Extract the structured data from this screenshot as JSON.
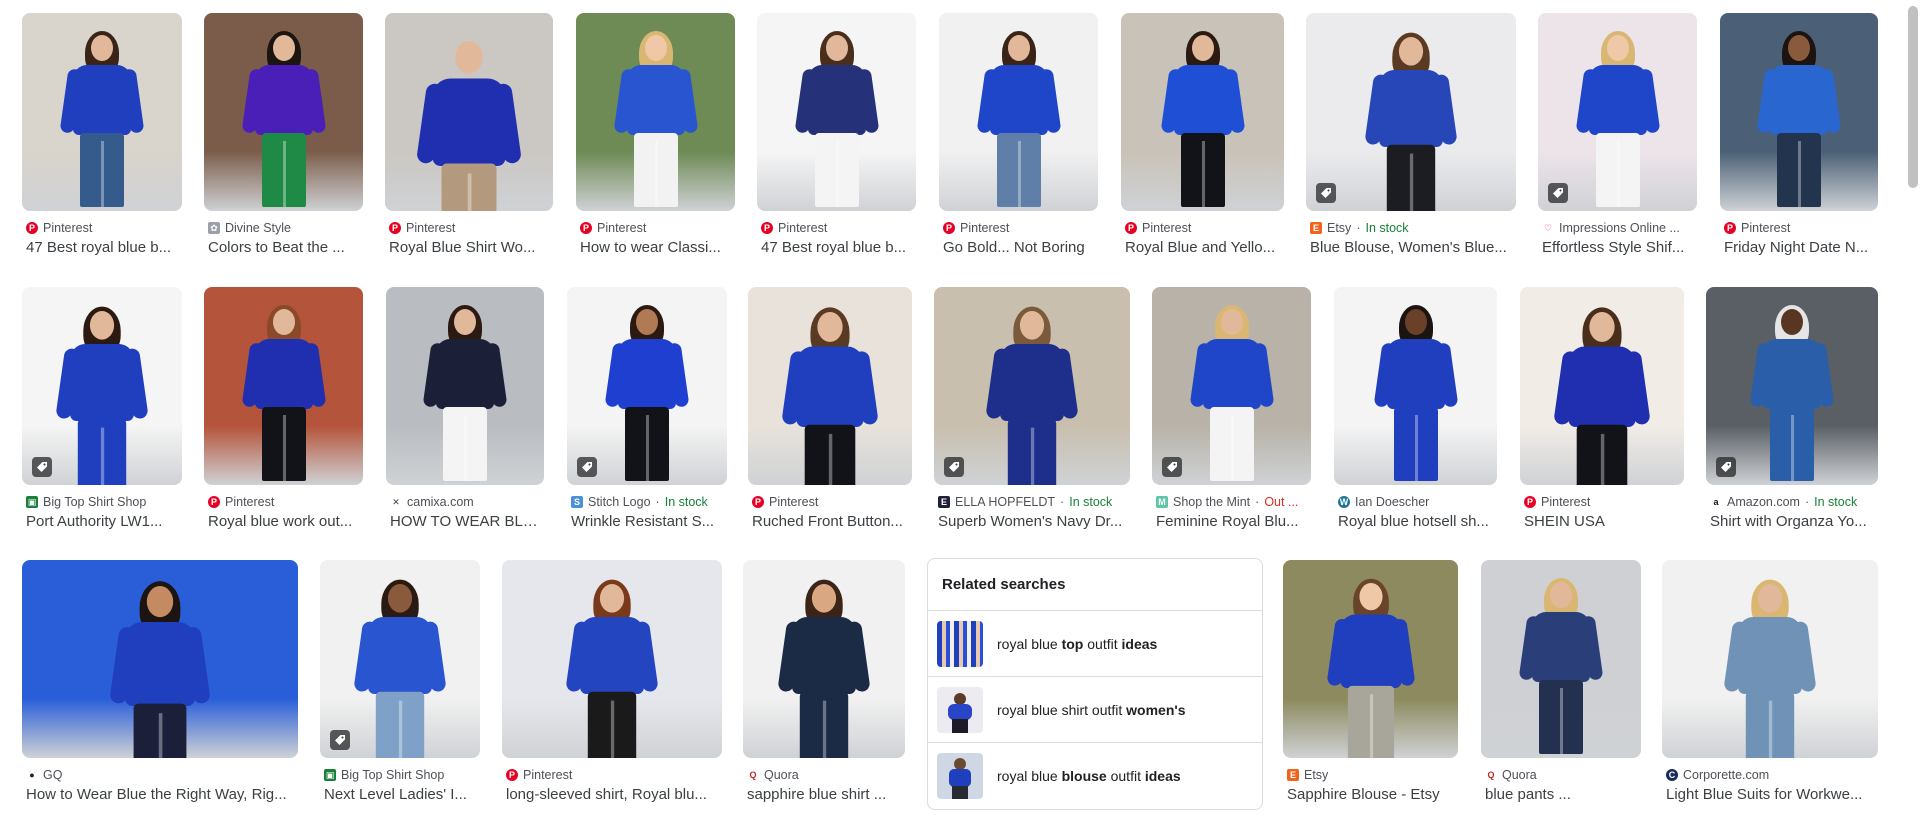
{
  "accent_blue": "#1f3fbf",
  "row1": [
    {
      "source": "Pinterest",
      "title": "47 Best royal blue b...",
      "fav": "pinterest",
      "shop": false
    },
    {
      "source": "Divine Style",
      "title": "Colors to Beat the ...",
      "fav": "divine",
      "shop": false
    },
    {
      "source": "Pinterest",
      "title": "Royal Blue Shirt Wo...",
      "fav": "pinterest",
      "shop": false
    },
    {
      "source": "Pinterest",
      "title": "How to wear Classi...",
      "fav": "pinterest",
      "shop": false
    },
    {
      "source": "Pinterest",
      "title": "47 Best royal blue b...",
      "fav": "pinterest",
      "shop": false
    },
    {
      "source": "Pinterest",
      "title": "Go Bold... Not Boring",
      "fav": "pinterest",
      "shop": false
    },
    {
      "source": "Pinterest",
      "title": "Royal Blue and Yello...",
      "fav": "pinterest",
      "shop": false
    },
    {
      "source": "Etsy",
      "stock": "In stock",
      "title": "Blue Blouse, Women's Blue...",
      "fav": "etsy",
      "shop": true
    },
    {
      "source": "Impressions Online ...",
      "title": "Effortless Style Shif...",
      "fav": "heart",
      "shop": true
    },
    {
      "source": "Pinterest",
      "title": "Friday Night Date N...",
      "fav": "pinterest",
      "shop": false
    }
  ],
  "row2": [
    {
      "source": "Big Top Shirt Shop",
      "title": "Port Authority LW1...",
      "fav": "bigtop",
      "shop": true
    },
    {
      "source": "Pinterest",
      "title": "Royal blue work out...",
      "fav": "pinterest",
      "shop": false
    },
    {
      "source": "camixa.com",
      "title": "HOW TO WEAR BLU...",
      "fav": "camixa",
      "shop": false
    },
    {
      "source": "Stitch Logo",
      "stock": "In stock",
      "title": "Wrinkle Resistant S...",
      "fav": "stitch",
      "shop": true
    },
    {
      "source": "Pinterest",
      "title": "Ruched Front Button...",
      "fav": "pinterest",
      "shop": false
    },
    {
      "source": "ELLA HOPFELDT",
      "stock": "In stock",
      "title": "Superb Women's Navy Dr...",
      "fav": "ella",
      "shop": true
    },
    {
      "source": "Shop the Mint",
      "stock": "Out ...",
      "title": "Feminine Royal Blu...",
      "fav": "mint",
      "shop": true
    },
    {
      "source": "Ian Doescher",
      "title": "Royal blue hotsell sh...",
      "fav": "wordpress",
      "shop": false
    },
    {
      "source": "Pinterest",
      "title": "SHEIN USA",
      "fav": "pinterest",
      "shop": false
    },
    {
      "source": "Amazon.com",
      "stock": "In stock",
      "title": "Shirt with Organza Yo...",
      "fav": "amazon",
      "shop": true
    }
  ],
  "row3": [
    {
      "source": "GQ",
      "title": "How to Wear Blue the Right Way, Rig...",
      "fav": "gq",
      "shop": false
    },
    {
      "source": "Big Top Shirt Shop",
      "title": "Next Level Ladies' I...",
      "fav": "bigtop",
      "shop": true
    },
    {
      "source": "Pinterest",
      "title": "long-sleeved shirt, Royal blu...",
      "fav": "pinterest",
      "shop": false
    },
    {
      "source": "Quora",
      "title": "sapphire blue shirt ...",
      "fav": "quora",
      "shop": false
    },
    {
      "source": "Etsy",
      "title": "Sapphire Blouse - Etsy",
      "fav": "etsy",
      "shop": false
    },
    {
      "source": "Quora",
      "title": "blue pants ...",
      "fav": "quora",
      "shop": false
    },
    {
      "source": "Corporette.com",
      "title": "Light Blue Suits for Workwe...",
      "fav": "corporette",
      "shop": false
    }
  ],
  "related": {
    "heading": "Related searches",
    "items": [
      {
        "pre": "royal blue ",
        "b1": "top",
        "mid": " outfit ",
        "b2": "ideas"
      },
      {
        "pre": "royal blue shirt outfit ",
        "b1": "women's",
        "mid": "",
        "b2": ""
      },
      {
        "pre": "royal blue ",
        "b1": "blouse",
        "mid": " outfit ",
        "b2": "ideas"
      }
    ]
  },
  "separator": "·"
}
